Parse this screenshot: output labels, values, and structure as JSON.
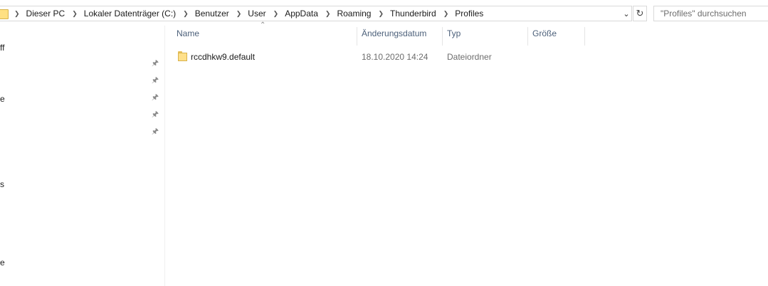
{
  "breadcrumb": [
    "Dieser PC",
    "Lokaler Datenträger (C:)",
    "Benutzer",
    "User",
    "AppData",
    "Roaming",
    "Thunderbird",
    "Profiles"
  ],
  "search": {
    "placeholder": "\"Profiles\" durchsuchen"
  },
  "nav_fragments": [
    "ff",
    "e",
    "s",
    "e"
  ],
  "columns": {
    "name": "Name",
    "date": "Änderungsdatum",
    "type": "Typ",
    "size": "Größe"
  },
  "files": [
    {
      "name": "rccdhkw9.default",
      "date": "18.10.2020 14:24",
      "type": "Dateiordner",
      "size": ""
    }
  ]
}
